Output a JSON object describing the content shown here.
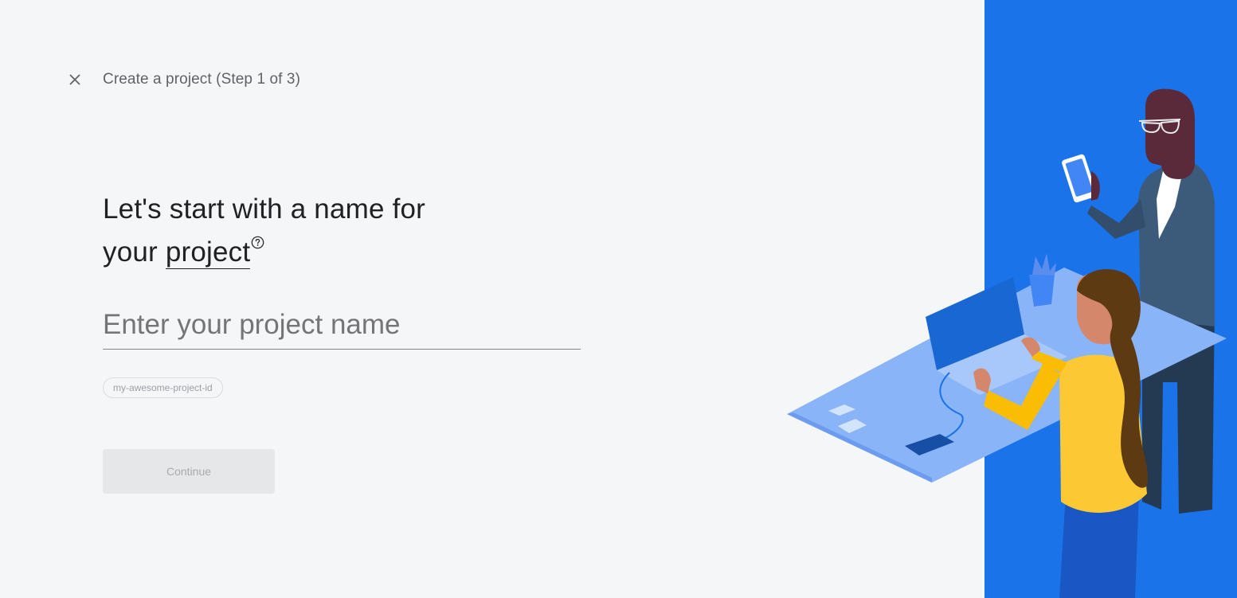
{
  "header": {
    "title": "Create a project (Step 1 of 3)",
    "close_icon": "close-icon"
  },
  "heading": {
    "line1": "Let's start with a name for",
    "line2_prefix": "your ",
    "line2_term": "project",
    "help_icon": "help-circle-icon"
  },
  "project_name_field": {
    "value": "",
    "placeholder": "Enter your project name"
  },
  "project_id_chip": {
    "label": "my-awesome-project-id"
  },
  "continue_button": {
    "label": "Continue",
    "enabled": false
  },
  "colors": {
    "background": "#f5f6f8",
    "accent_panel": "#1a73e8",
    "desk": "#8ab4f8",
    "shirt_yellow": "#fcc934"
  }
}
